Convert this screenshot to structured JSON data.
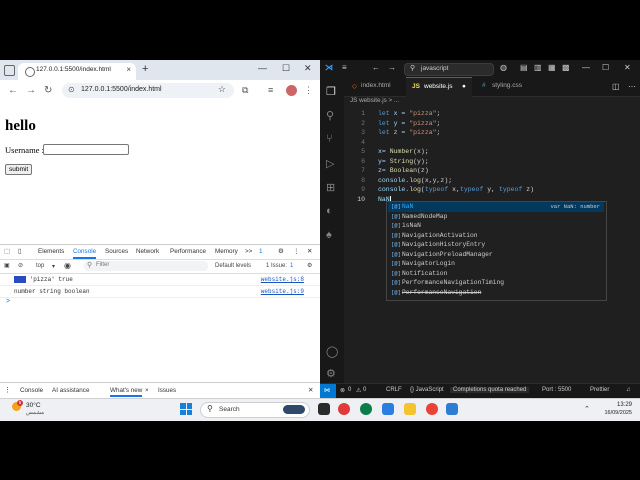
{
  "browser": {
    "tab_title": "127.0.0.1:5500/index.html",
    "url": "127.0.0.1:5500/index.html",
    "page": {
      "heading": "hello",
      "username_label": "Username :",
      "username_value": "",
      "submit_label": "submit"
    },
    "devtools": {
      "tabs": [
        "Elements",
        "Console",
        "Sources",
        "Network",
        "Performance",
        "Memory"
      ],
      "more": ">>",
      "issues_count": "1",
      "context": "top",
      "filter_placeholder": "Filter",
      "levels": "Default levels",
      "issue_label": "1 Issue:",
      "issue_count2": "1",
      "logs": [
        {
          "text": "'pizza' true",
          "link": "website.js:8"
        },
        {
          "text": "number string boolean",
          "link": "website.js:9"
        }
      ],
      "prompt": ">",
      "drawer_tabs": [
        "Console",
        "AI assistance",
        "What's new",
        "Issues"
      ]
    }
  },
  "vscode": {
    "search": "javascript",
    "tabs": [
      {
        "label": "index.html",
        "color": "#e37933"
      },
      {
        "label": "website.js",
        "color": "#f1e05a"
      },
      {
        "label": "styling.css",
        "color": "#519aba"
      }
    ],
    "breadcrumb": "JS website.js > ...",
    "lines": [
      "1",
      "2",
      "3",
      "4",
      "5",
      "6",
      "7",
      "8",
      "9",
      "10"
    ],
    "code": {
      "l1": [
        "let",
        " x = ",
        "\"pizza\"",
        ";"
      ],
      "l2": [
        "let",
        " y = ",
        "\"pizza\"",
        ";"
      ],
      "l3": [
        "let",
        " z = ",
        "\"pizza\"",
        ";"
      ],
      "l5": [
        "x= ",
        "Number",
        "(x);"
      ],
      "l6": [
        "y= ",
        "String",
        "(y);"
      ],
      "l7": [
        "z= ",
        "Boolean",
        "(z)"
      ],
      "l8": [
        "console.",
        "log",
        "(x,y,z);"
      ],
      "l9": [
        "console.",
        "log",
        "(",
        "typeof",
        " x,",
        "typeof",
        " y, ",
        "typeof",
        " z)"
      ],
      "l10": "NaN"
    },
    "autocomplete": [
      {
        "icon": "[@]",
        "label": "NaN",
        "detail": "var NaN: number"
      },
      {
        "icon": "[@]",
        "label": "NamedNodeMap",
        "detail": ""
      },
      {
        "icon": "[@]",
        "label": "isNaN",
        "detail": ""
      },
      {
        "icon": "[@]",
        "label": "NavigationActivation",
        "detail": ""
      },
      {
        "icon": "[@]",
        "label": "NavigationHistoryEntry",
        "detail": ""
      },
      {
        "icon": "[@]",
        "label": "NavigationPreloadManager",
        "detail": ""
      },
      {
        "icon": "[@]",
        "label": "NavigatorLogin",
        "detail": ""
      },
      {
        "icon": "[@]",
        "label": "Notification",
        "detail": ""
      },
      {
        "icon": "[@]",
        "label": "PerformanceNavigationTiming",
        "detail": ""
      },
      {
        "icon": "[@]",
        "label": "PerformanceNavigation",
        "detail": ""
      }
    ],
    "status": {
      "errors": "0",
      "warnings": "0",
      "eol": "CRLF",
      "lang": "{} JavaScript",
      "quota": "Completions quota reached",
      "port": "Port : 5500",
      "prettier": "Prettier"
    }
  },
  "taskbar": {
    "temp": "30°C",
    "condition": "مشمس",
    "badge": "5",
    "search_placeholder": "Search",
    "time": "13:29",
    "date": "16/09/2025"
  },
  "colors": {
    "vs_accent": "#0078d4",
    "devtools_accent": "#1a73e8"
  }
}
